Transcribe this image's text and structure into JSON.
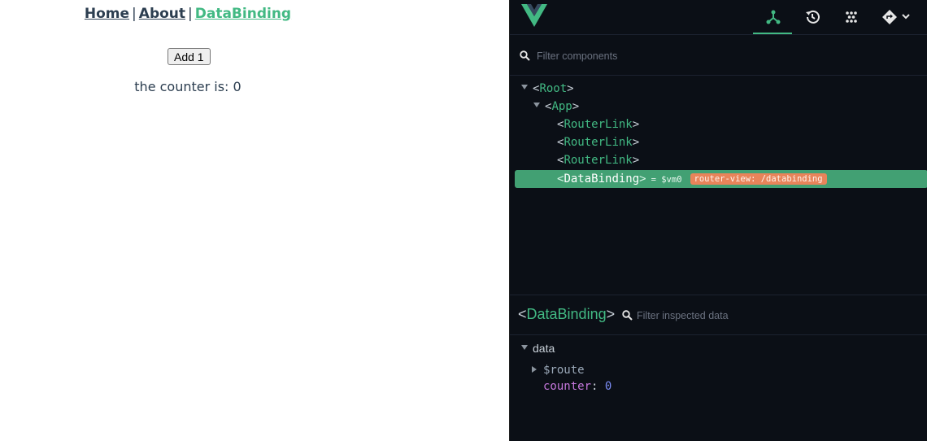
{
  "app": {
    "nav": [
      {
        "label": "Home",
        "active": false
      },
      {
        "label": "About",
        "active": false
      },
      {
        "label": "DataBinding",
        "active": true
      }
    ],
    "nav_separator": "|",
    "button_label": "Add 1",
    "counter_text": "the counter is: 0"
  },
  "devtools": {
    "toolbar_icons": [
      "components-icon",
      "timeline-icon",
      "plugins-icon",
      "router-icon"
    ],
    "filter_placeholder": "Filter components",
    "tree": [
      {
        "open": "<",
        "name": "Root",
        "close": ">",
        "depth": 0,
        "expanded": true
      },
      {
        "open": "<",
        "name": "App",
        "close": ">",
        "depth": 1,
        "expanded": true
      },
      {
        "open": "<",
        "name": "RouterLink",
        "close": ">",
        "depth": 2
      },
      {
        "open": "<",
        "name": "RouterLink",
        "close": ">",
        "depth": 2
      },
      {
        "open": "<",
        "name": "RouterLink",
        "close": ">",
        "depth": 2
      },
      {
        "open": "<",
        "name": "DataBinding",
        "close": ">",
        "depth": 2,
        "selected": true,
        "vm": "= $vm0",
        "badge": "router-view: /databinding"
      }
    ],
    "inspector": {
      "open": "<",
      "name": "DataBinding",
      "close": ">",
      "filter_placeholder": "Filter inspected data",
      "section": "data",
      "props": [
        {
          "key": "$route",
          "collapsed": true
        },
        {
          "key": "counter",
          "colon": ":",
          "value": "0"
        }
      ]
    },
    "colors": {
      "accent": "#42b983",
      "selected_row": "#42a073",
      "badge": "#e8845a",
      "background": "#0b0f16"
    }
  }
}
